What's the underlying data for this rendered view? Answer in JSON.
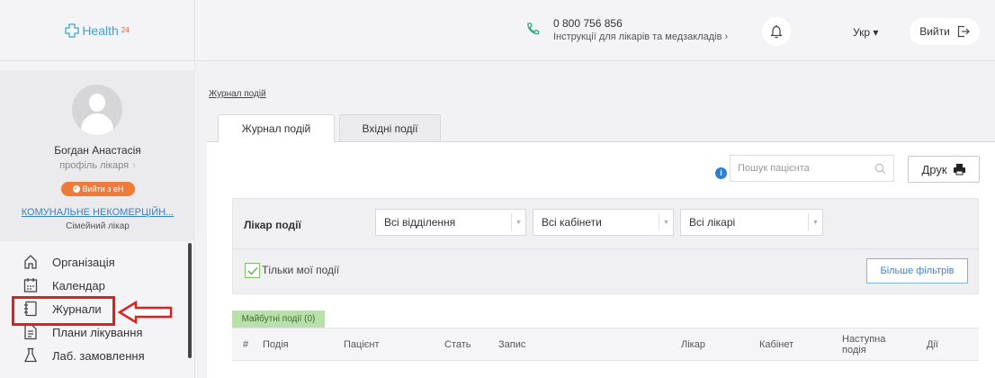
{
  "sidebar": {
    "logo_text": "Health",
    "logo_sup": "24",
    "profile": {
      "name": "Богдан Анастасія",
      "profile_link": "профіль лікаря",
      "exit_eh": "Вийти з еН",
      "organization": "КОМУНАЛЬНЕ НЕКОМЕРЦІЙН...",
      "role": "Сімейний лікар"
    },
    "items": [
      {
        "label": "Організація",
        "icon": "home-icon"
      },
      {
        "label": "Календар",
        "icon": "calendar-icon"
      },
      {
        "label": "Журнали",
        "icon": "journal-icon"
      },
      {
        "label": "Плани лікування",
        "icon": "treatment-plan-icon"
      },
      {
        "label": "Лаб. замовлення",
        "icon": "flask-icon"
      }
    ]
  },
  "header": {
    "phone": "0 800 756 856",
    "instructions": "Інструкції для лікарів та медзакладів",
    "language": "Укр",
    "logout": "Вийти"
  },
  "main": {
    "breadcrumb": "Журнал подій",
    "tabs": [
      {
        "label": "Журнал подій",
        "active": true
      },
      {
        "label": "Вхідні події",
        "active": false
      }
    ],
    "search": {
      "placeholder": "Пошук пацієнта",
      "value": ""
    },
    "print_label": "Друк",
    "filters": {
      "label": "Лікар події",
      "department": "Всі відділення",
      "cabinet": "Всі кабінети",
      "doctor": "Всі лікарі",
      "only_my_events": "Тільки мої події",
      "only_my_events_checked": true,
      "more_filters": "Більше фільтрів"
    },
    "upcoming_label": "Майбутні події (0)",
    "table": {
      "columns": [
        "#",
        "Подія",
        "Пацієнт",
        "Стать",
        "Запис",
        "Лікар",
        "Кабінет",
        "Наступна подія",
        "Дії"
      ]
    }
  },
  "colors": {
    "brand": "#3c9fd8",
    "accent_orange": "#ef7b3a",
    "upcoming_green": "#b9e0aa",
    "annotation_red": "#e02020"
  }
}
